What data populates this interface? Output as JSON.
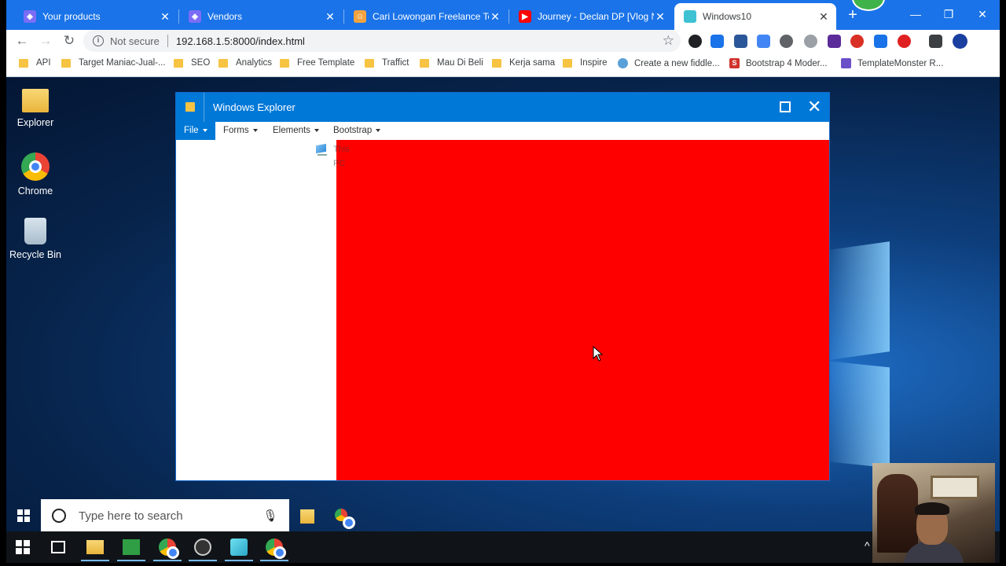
{
  "browser": {
    "tabs": [
      {
        "title": "Your products",
        "favicon_color": "#7b6cf6",
        "active": false
      },
      {
        "title": "Vendors",
        "favicon_color": "#7b6cf6",
        "active": false
      },
      {
        "title": "Cari Lowongan Freelance Terbaru",
        "favicon_color": "#f4a340",
        "active": false
      },
      {
        "title": "Journey - Declan DP [Vlog No Copyright]",
        "favicon_color": "#ff0000",
        "active": false
      },
      {
        "title": "Windows10",
        "favicon_color": "#3ec1d3",
        "active": true
      }
    ],
    "new_tab_label": "+",
    "window_controls": {
      "minimize": "—",
      "restore": "❐",
      "close": "✕"
    },
    "toolbar": {
      "back": "←",
      "forward": "→",
      "reload": "↻",
      "security_label": "Not secure",
      "url": "192.168.1.5:8000/index.html",
      "star": "☆"
    },
    "extensions": [
      {
        "name": "extension-1-icon",
        "color": "#202124"
      },
      {
        "name": "extension-new-icon",
        "color": "#1a73e8"
      },
      {
        "name": "extension-printer-icon",
        "color": "#2b579a"
      },
      {
        "name": "extension-translate-icon",
        "color": "#4285f4"
      },
      {
        "name": "extension-recycle-icon",
        "color": "#5f6368"
      },
      {
        "name": "extension-bolt-icon",
        "color": "#9aa0a6"
      },
      {
        "name": "extension-cube-icon",
        "color": "#5b2c99"
      },
      {
        "name": "extension-no-icon",
        "color": "#d93025"
      },
      {
        "name": "extension-download-icon",
        "color": "#1a73e8"
      },
      {
        "name": "extension-opera-icon",
        "color": "#e02020"
      },
      {
        "name": "extension-list-icon",
        "color": "#3c4043"
      },
      {
        "name": "profile-avatar-icon",
        "color": "#1a3fa0"
      }
    ],
    "bookmarks": [
      {
        "label": "API",
        "type": "folder"
      },
      {
        "label": "Target Maniac-Jual-...",
        "type": "folder"
      },
      {
        "label": "SEO",
        "type": "folder"
      },
      {
        "label": "Analytics",
        "type": "folder"
      },
      {
        "label": "Free Template",
        "type": "folder"
      },
      {
        "label": "Traffict",
        "type": "folder"
      },
      {
        "label": "Mau Di Beli",
        "type": "folder"
      },
      {
        "label": "Kerja sama",
        "type": "folder"
      },
      {
        "label": "Inspire",
        "type": "folder"
      },
      {
        "label": "Create a new fiddle...",
        "type": "site",
        "favicon_color": "#5aa0d8"
      },
      {
        "label": "Bootstrap 4 Moder...",
        "type": "site",
        "favicon_color": "#d0342c",
        "favicon_letter": "S"
      },
      {
        "label": "TemplateMonster R...",
        "type": "site",
        "favicon_color": "#6a4fc8"
      }
    ]
  },
  "desktop": {
    "icons": [
      {
        "label": "Explorer",
        "icon": "folder-icon"
      },
      {
        "label": "Chrome",
        "icon": "chrome-icon"
      },
      {
        "label": "Recycle Bin",
        "icon": "recycle-bin-icon"
      }
    ],
    "explorer_window": {
      "title": "Windows Explorer",
      "maximize": "maximize-icon",
      "close": "✕",
      "menus": [
        {
          "label": "File",
          "active": true
        },
        {
          "label": "Forms",
          "active": false
        },
        {
          "label": "Elements",
          "active": false
        },
        {
          "label": "Bootstrap",
          "active": false
        }
      ],
      "nav_item": "This PC",
      "content_color": "#ff0000"
    },
    "taskbar_search": {
      "placeholder": "Type here to search",
      "pinned": [
        "file-explorer-icon",
        "chrome-icon"
      ]
    },
    "taskbar": {
      "apps": [
        {
          "name": "start-icon"
        },
        {
          "name": "task-view-icon"
        },
        {
          "name": "file-explorer-icon",
          "running": true
        },
        {
          "name": "notepad-icon",
          "running": true
        },
        {
          "name": "chrome-icon",
          "running": true
        },
        {
          "name": "obs-icon",
          "running": true
        },
        {
          "name": "app-cube-icon",
          "running": true
        },
        {
          "name": "chrome-icon",
          "running": true
        }
      ],
      "tray_chevron": "^"
    }
  }
}
